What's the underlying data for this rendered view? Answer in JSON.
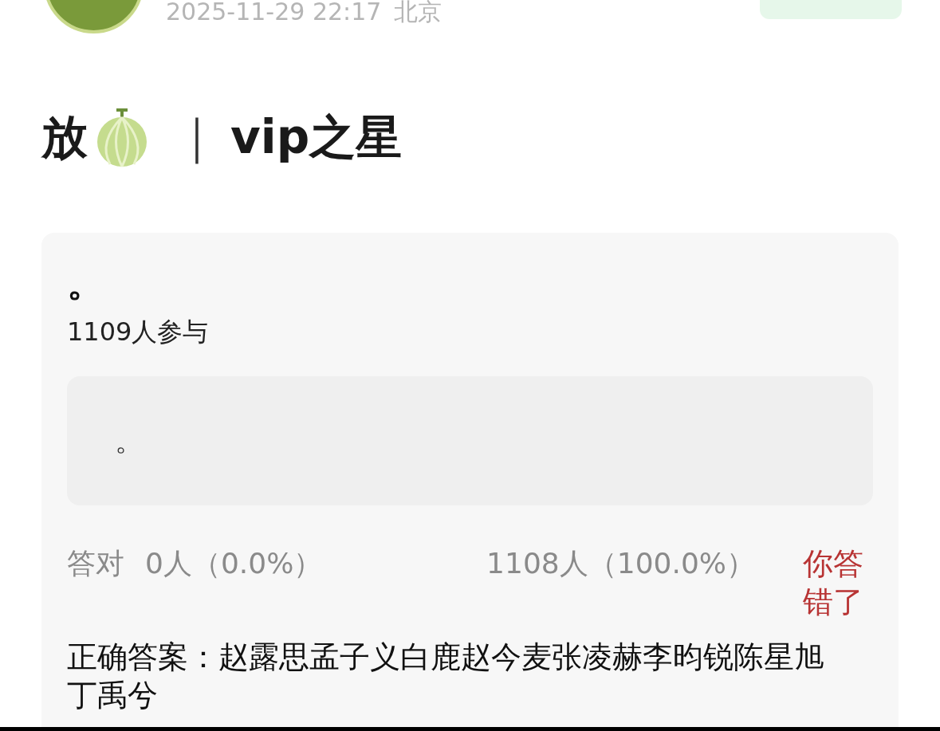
{
  "post": {
    "timestamp": "2025-11-29 22:17",
    "location": "北京",
    "title_start": "放",
    "title_separator": "｜",
    "title_end": "vip之星"
  },
  "poll": {
    "question": "。",
    "participants": "1109人参与",
    "options": [
      {
        "text": "。"
      }
    ],
    "results": {
      "correct_label": "答对",
      "correct_count": "0人（0.0%）",
      "wrong_count": "1108人（100.0%）",
      "verdict": "你答错了"
    },
    "answer": "正确答案：赵露思孟子义白鹿赵今麦张凌赫李昀锐陈星旭丁禹兮"
  }
}
